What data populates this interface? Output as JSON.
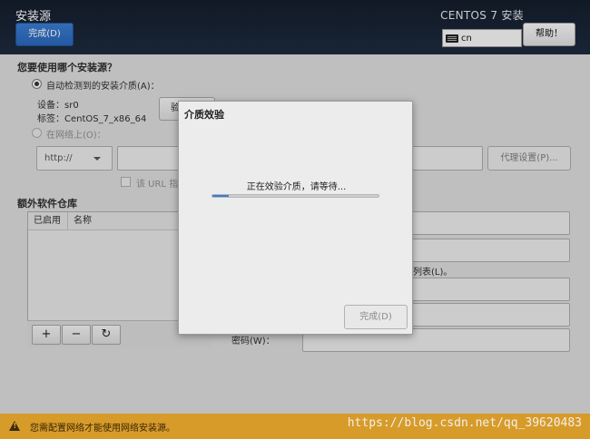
{
  "header": {
    "title": "安装源",
    "done_label": "完成(D)",
    "product": "CENTOS 7 安装",
    "keyboard_layout": "cn",
    "help_label": "帮助！"
  },
  "source": {
    "question": "您要使用哪个安装源？",
    "auto_detect_label": "自动检测到的安装介质(A)：",
    "device_label": "设备：sr0",
    "volume_label": "标签：CentOS_7_x86_64",
    "verify_label": "验",
    "network_label": "在网络上(O)：",
    "protocol_value": "http://",
    "proxy_label": "代理设置(P)...",
    "url_checkbox_label": "该 URL 指"
  },
  "repos": {
    "title": "额外软件仓库",
    "col_enabled": "已启用",
    "col_name": "名称",
    "add": "+",
    "remove": "−",
    "refresh": "↻",
    "list_hint": "像列表(L)。",
    "password_label": "密码(W)："
  },
  "dialog": {
    "title": "介质效验",
    "message": "正在效验介质，请等待...",
    "progress": 0.1,
    "done_label": "完成(D)"
  },
  "footer": {
    "warning": "您需配置网络才能使用网络安装源。",
    "watermark": "https://blog.csdn.net/qq_39620483"
  },
  "colors": {
    "accent": "#3b7ad3",
    "warning_bar": "#d79b2a",
    "header_bg": "#172233"
  }
}
